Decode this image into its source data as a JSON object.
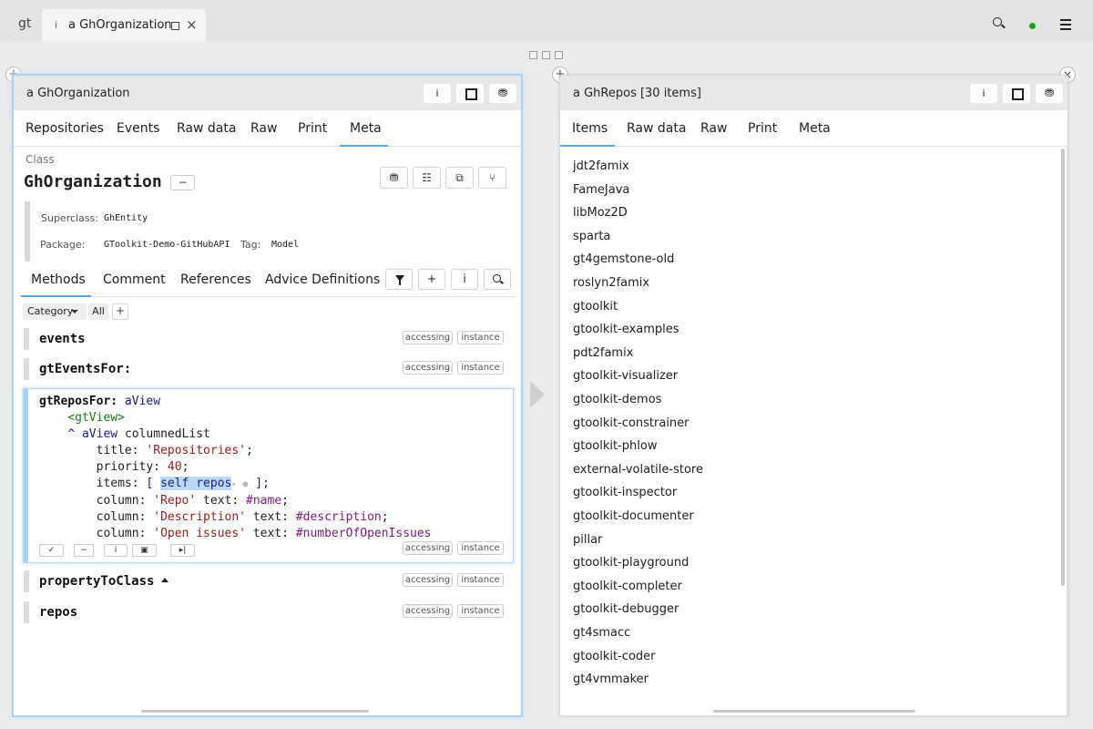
{
  "topbar": {
    "logo": "gt",
    "tab_info_icon": "i",
    "tab_label": "a GhOrganization",
    "tab_close": "×",
    "search_icon": "search-icon",
    "status_color": "#1ba11b"
  },
  "left": {
    "title": "a GhOrganization",
    "header_buttons": {
      "info": "i",
      "book": "⛃"
    },
    "tabs": [
      "Repositories",
      "Events",
      "Raw data",
      "Raw",
      "Print",
      "Meta"
    ],
    "active_tab": "Meta",
    "class_label": "Class",
    "class_name": "GhOrganization",
    "minus": "−",
    "superclass_key": "Superclass:",
    "superclass_val": "GhEntity",
    "package_key": "Package:",
    "package_val": "GToolkit-Demo-GitHubAPI",
    "tag_key": "Tag:",
    "tag_val": "Model",
    "sub_tabs": [
      "Methods",
      "Comment",
      "References",
      "Advice Definitions"
    ],
    "active_sub_tab": "Methods",
    "sub_btn_plus": "+",
    "sub_btn_info": "i",
    "category_label": "Category",
    "category_all": "All",
    "category_plus": "+",
    "methods": [
      {
        "name": "events",
        "protocol": "accessing",
        "side": "instance"
      },
      {
        "name": "gtEventsFor:",
        "protocol": "accessing",
        "side": "instance"
      },
      {
        "name": "propertyToClass",
        "protocol": "accessing",
        "side": "instance"
      },
      {
        "name": "repos",
        "protocol": "accessing",
        "side": "instance"
      }
    ],
    "editor": {
      "selector": "gtReposFor:",
      "arg": "aView",
      "pragma": "<gtView>",
      "caret": "^",
      "line3_rest": "columnedList",
      "title_kw": "title:",
      "title_str": "'Repositories'",
      "priority_kw": "priority:",
      "priority_num": "40",
      "items_kw": "items:",
      "items_open": "[",
      "items_sel": "self repos",
      "items_close": "];",
      "col_kw": "column:",
      "text_kw": "text:",
      "col1_str": "'Repo'",
      "col1_sym": "#name",
      "col2_str": "'Description'",
      "col2_sym": "#description",
      "col3_str": "'Open issues'",
      "col3_sym": "#numberOfOpenIssues",
      "protocol": "accessing",
      "side": "instance",
      "buttons": {
        "accept": "✓",
        "minus": "−",
        "info": "i",
        "paste": "▣",
        "run": "▸|"
      }
    }
  },
  "right": {
    "title": "a GhRepos [30 items]",
    "header_buttons": {
      "info": "i",
      "book": "⛃"
    },
    "tabs": [
      "Items",
      "Raw data",
      "Raw",
      "Print",
      "Meta"
    ],
    "active_tab": "Items",
    "items": [
      "jdt2famix",
      "FameJava",
      "libMoz2D",
      "sparta",
      "gt4gemstone-old",
      "roslyn2famix",
      "gtoolkit",
      "gtoolkit-examples",
      "pdt2famix",
      "gtoolkit-visualizer",
      "gtoolkit-demos",
      "gtoolkit-constrainer",
      "gtoolkit-phlow",
      "external-volatile-store",
      "gtoolkit-inspector",
      "gtoolkit-documenter",
      "pillar",
      "gtoolkit-playground",
      "gtoolkit-completer",
      "gtoolkit-debugger",
      "gt4smacc",
      "gtoolkit-coder",
      "gt4vmmaker"
    ],
    "close": "×"
  },
  "plus": "+"
}
